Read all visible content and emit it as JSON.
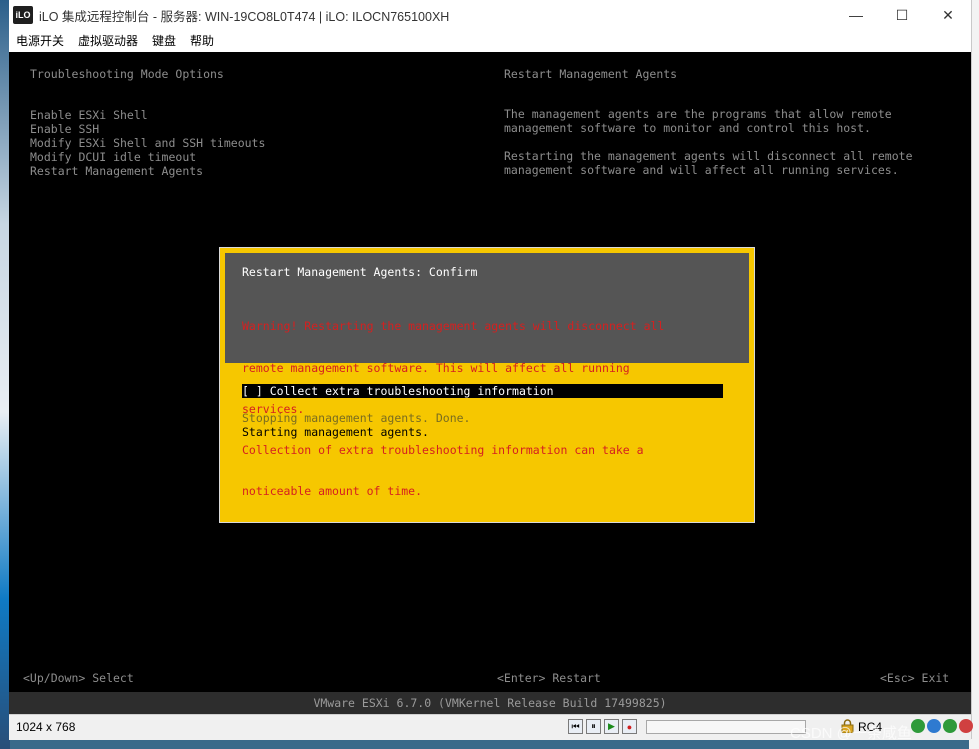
{
  "window": {
    "title": "iLO 集成远程控制台 - 服务器: WIN-19CO8L0T474 | iLO: ILOCN765100XH",
    "app_icon_text": "iLO",
    "minimize_glyph": "—",
    "maximize_glyph": "☐",
    "close_glyph": "✕"
  },
  "menu": {
    "items": [
      "电源开关",
      "虚拟驱动器",
      "键盘",
      "帮助"
    ]
  },
  "console": {
    "left_header": "Troubleshooting Mode Options",
    "right_header": "Restart Management Agents",
    "options": [
      "Enable ESXi Shell",
      "Enable SSH",
      "Modify ESXi Shell and SSH timeouts",
      "Modify DCUI idle timeout",
      "Restart Management Agents"
    ],
    "description": [
      "The management agents are the programs that allow remote",
      "management software to monitor and control this host.",
      "",
      "Restarting the management agents will disconnect all remote",
      "management software and will affect all running services."
    ],
    "footer": {
      "left": "<Up/Down> Select",
      "middle": "<Enter> Restart",
      "right": "<Esc> Exit"
    },
    "vmware_line": "VMware ESXi 6.7.0 (VMKernel Release Build 17499825)"
  },
  "dialog": {
    "title": "Restart Management Agents: Confirm",
    "warning_lines": [
      "Warning! Restarting the management agents will disconnect all",
      "remote management software. This will affect all running",
      "services.",
      "Collection of extra troubleshooting information can take a",
      "noticeable amount of time."
    ],
    "checkbox": "[ ] Collect extra troubleshooting information",
    "status_done": "Stopping management agents. Done.",
    "status_current": "Starting management agents."
  },
  "statusbar": {
    "resolution": "1024 x 768",
    "encryption": "RC4",
    "progress": 0
  },
  "watermark": "CSDN @一条咸鱼",
  "colors": {
    "warning": "#d52020",
    "dialog_bg": "#f6c700",
    "dialog_header": "#555555",
    "console_text": "#8d8d8d"
  }
}
